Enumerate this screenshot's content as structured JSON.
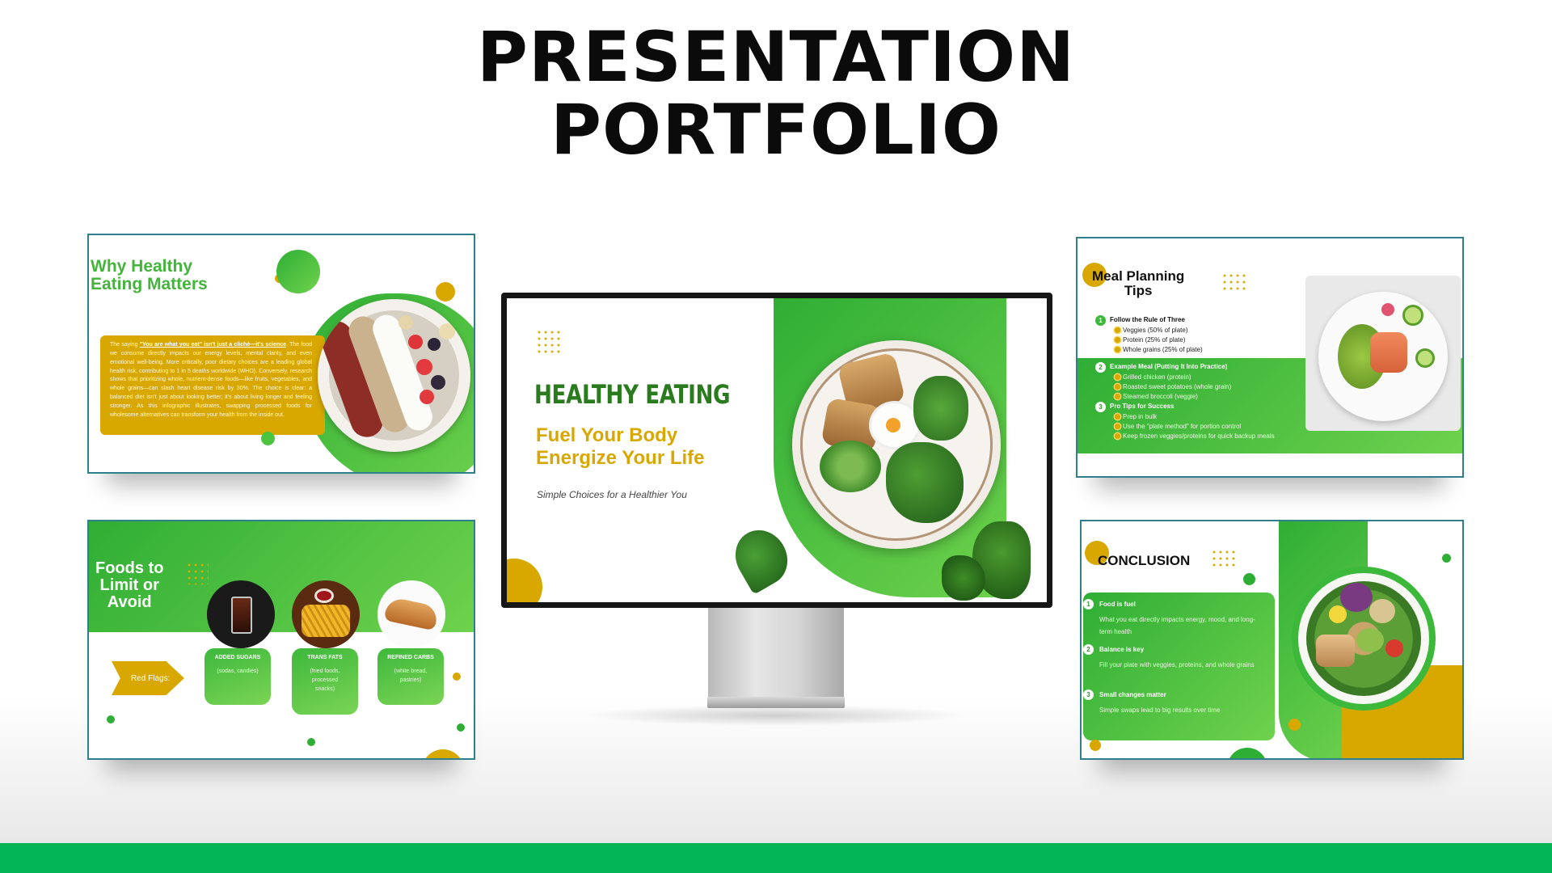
{
  "header": {
    "line1": "PRESENTATION",
    "line2": "PORTFOLIO"
  },
  "colors": {
    "green": "#3cb83a",
    "light_green": "#7bd455",
    "yellow": "#d9a800",
    "dark_green": "#1f7a1f",
    "bar": "#03b554"
  },
  "slides": {
    "why": {
      "title_line1": "Why Healthy",
      "title_line2": "Eating Matters",
      "intro": "The saying ",
      "quote": "\"You are what you eat\" isn't just a cliché—it's science",
      "body": ". The food we consume directly impacts our energy levels, mental clarity, and even emotional well-being. More critically, poor dietary choices are a leading global health risk, contributing to 1 in 5 deaths worldwide (WHO). Conversely, research shows that prioritizing whole, nutrient-dense foods—like fruits, vegetables, and whole grains—can slash heart disease risk by 30%. The choice is clear: a balanced diet isn't just about looking better; it's about living longer and feeling stronger. As this infographic illustrates, swapping processed foods for wholesome alternatives can transform your health from the inside out.",
      "image_icon": "smoothie-bowl-icon"
    },
    "foods": {
      "title_line1": "Foods to",
      "title_line2": "Limit or",
      "title_line3": "Avoid",
      "flag_label": "Red Flags:",
      "cards": [
        {
          "title": "ADDED SUGARS",
          "sub": "(sodas, candies)",
          "icon": "soda-icon"
        },
        {
          "title": "TRANS FATS",
          "sub": "(fried foods, processed snacks)",
          "icon": "fries-icon"
        },
        {
          "title": "REFINED CARBS",
          "sub": "(white bread, pastries)",
          "icon": "bread-icon"
        }
      ]
    },
    "main": {
      "title": "HEALTHY EATING",
      "tagline1": "Fuel Your Body",
      "tagline2": "Energize Your Life",
      "subtitle": "Simple Choices for a Healthier You",
      "image_icon": "salad-plate-icon"
    },
    "meal": {
      "title_line1": "Meal Planning",
      "title_line2": "Tips",
      "sections": [
        {
          "num": "1",
          "head": "Follow the Rule of Three",
          "items": [
            "Veggies (50% of plate)",
            "Protein (25% of plate)",
            "Whole grains (25% of plate)"
          ]
        },
        {
          "num": "2",
          "head": "Example Meal (Putting It Into Practice)",
          "items": [
            "Grilled chicken (protein)",
            "Roasted sweet potatoes (whole grain)",
            "Steamed broccoli (veggie)"
          ]
        },
        {
          "num": "3",
          "head": "Pro Tips for Success",
          "items": [
            "Prep in bulk",
            "Use the \"plate method\" for portion control",
            "Keep frozen veggies/proteins for quick backup meals"
          ]
        }
      ],
      "image_icon": "salmon-salad-icon"
    },
    "conclusion": {
      "title": "CONCLUSION",
      "points": [
        {
          "num": "1",
          "head": "Food is fuel",
          "text": "What you eat directly impacts energy, mood, and long-term health"
        },
        {
          "num": "2",
          "head": "Balance is key",
          "text": "Fill your plate with veggies, proteins, and whole grains"
        },
        {
          "num": "3",
          "head": "Small changes matter",
          "text": "Simple swaps lead to big results over time"
        }
      ],
      "image_icon": "chicken-salad-bowl-icon"
    }
  }
}
